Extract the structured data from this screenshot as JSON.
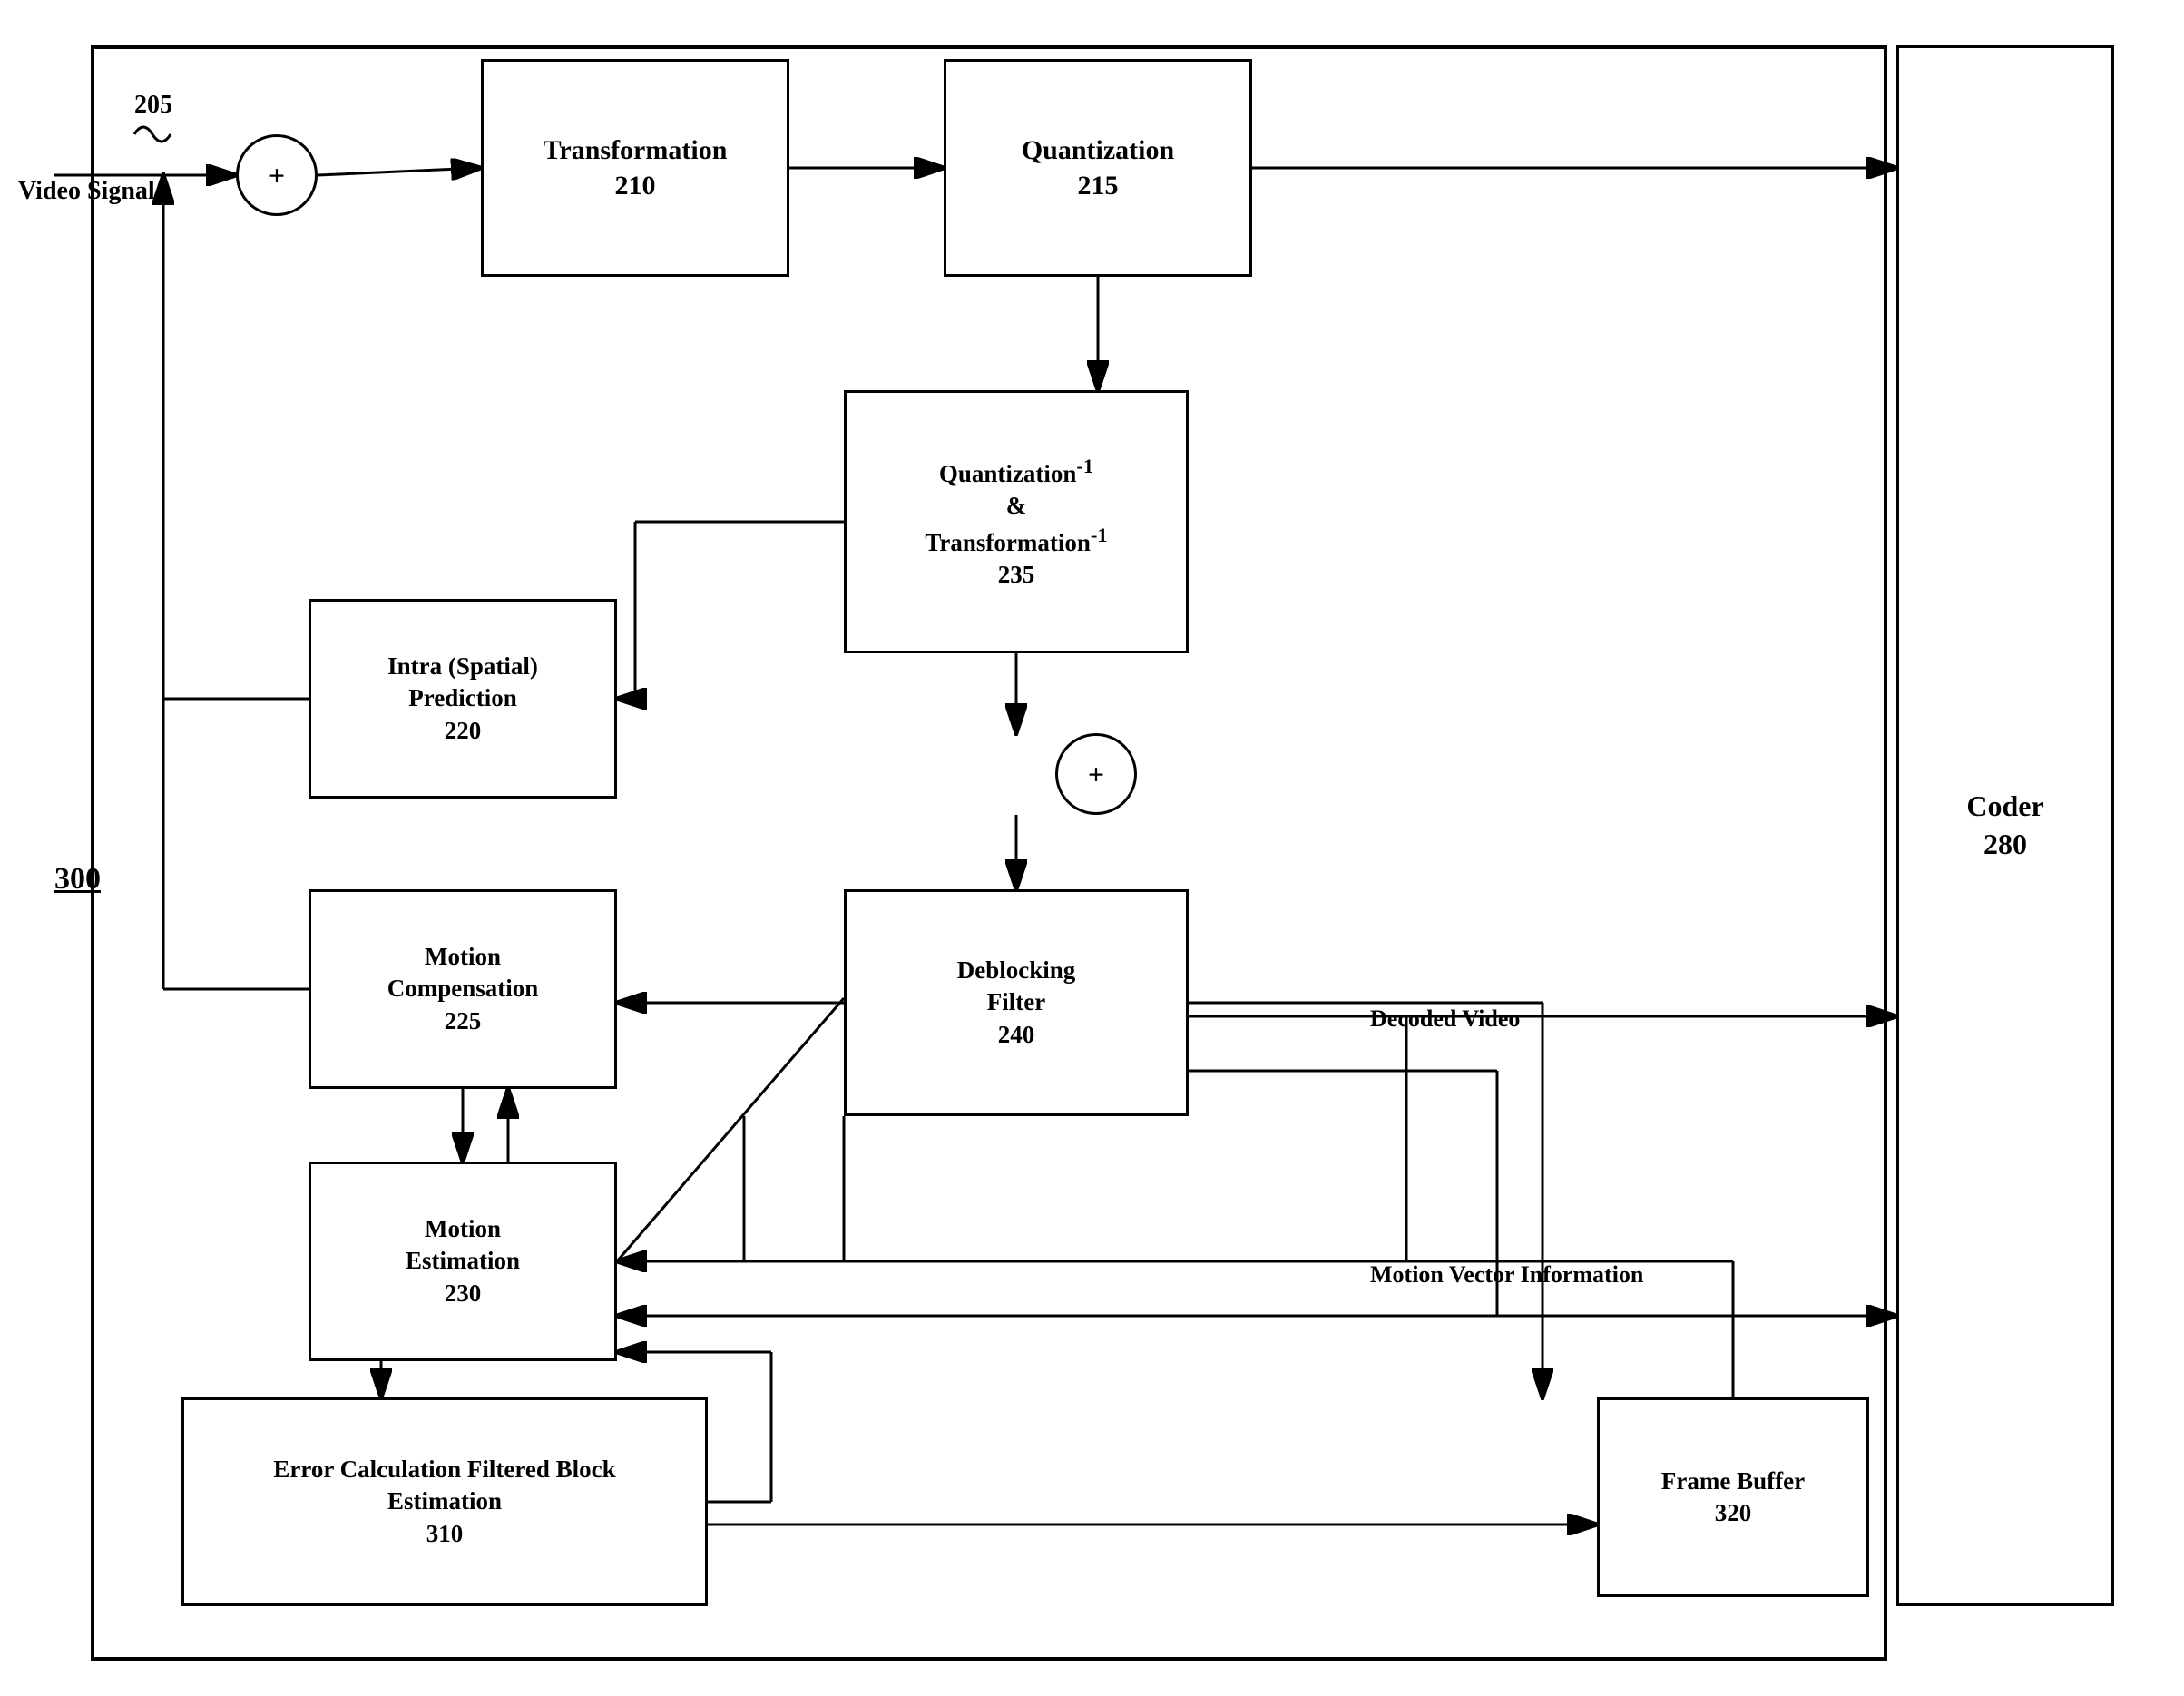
{
  "blocks": {
    "transformation": {
      "label": "Transformation\n210",
      "id": "transformation-block"
    },
    "quantization": {
      "label": "Quantization\n215",
      "id": "quantization-block"
    },
    "quantization_inv": {
      "label": "Quantization⁻¹\n&\nTransformation⁻¹\n235",
      "id": "quantization-inv-block"
    },
    "intra_prediction": {
      "label": "Intra (Spatial)\nPrediction\n220",
      "id": "intra-prediction-block"
    },
    "motion_compensation": {
      "label": "Motion\nCompensation\n225",
      "id": "motion-compensation-block"
    },
    "motion_estimation": {
      "label": "Motion\nEstimation\n230",
      "id": "motion-estimation-block"
    },
    "deblocking_filter": {
      "label": "Deblocking\nFilter\n240",
      "id": "deblocking-filter-block"
    },
    "error_calc": {
      "label": "Error Calculation Filtered Block\nEstimation\n310",
      "id": "error-calc-block"
    },
    "frame_buffer": {
      "label": "Frame Buffer\n320",
      "id": "frame-buffer-block"
    },
    "coder": {
      "label": "Coder\n280",
      "id": "coder-block"
    }
  },
  "labels": {
    "video_signal": "Video Signal",
    "signal_205": "205",
    "label_300": "300",
    "decoded_video": "Decoded Video",
    "motion_vector": "Motion Vector Information"
  },
  "circles": {
    "adder1": "+",
    "adder2": "+"
  }
}
